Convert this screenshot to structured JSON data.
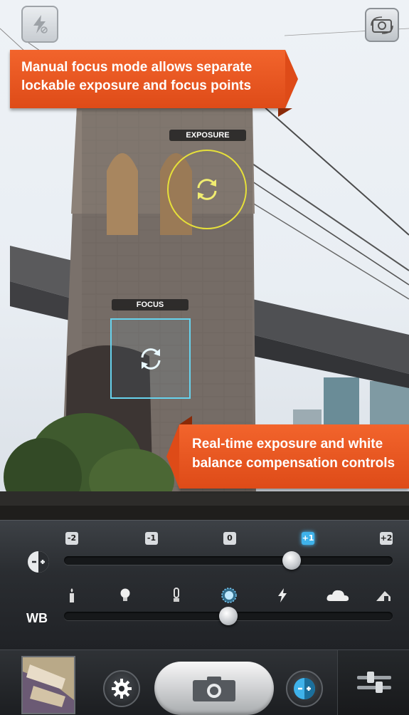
{
  "annotations": {
    "top_ribbon": [
      "Manual focus mode allows separate",
      "lockable exposure and focus points"
    ],
    "bottom_ribbon": [
      "Real-time exposure and white",
      "balance compensation controls"
    ]
  },
  "overlays": {
    "exposure_label": "EXPOSURE",
    "focus_label": "FOCUS"
  },
  "top_controls": {
    "flash_icon": "flash-off-icon",
    "camera_flip_icon": "camera-switch-icon"
  },
  "exposure": {
    "icon": "exposure-compensation-icon",
    "labels": [
      "-2",
      "-1",
      "0",
      "+1",
      "+2"
    ],
    "selected": "+1",
    "value_fraction": 0.75
  },
  "white_balance": {
    "label": "WB",
    "presets": [
      "candle-icon",
      "bulb-icon",
      "fluorescent-icon",
      "daylight-icon",
      "flash-icon",
      "cloudy-icon",
      "shade-icon"
    ],
    "selected": "daylight-icon",
    "value_fraction": 0.5,
    "accent": "#3fb2ea"
  },
  "bottom_bar": {
    "gallery_icon": "photo-thumbnail",
    "settings_icon": "gear-icon",
    "shutter_icon": "camera-icon",
    "mode_icon": "exposure-mode-icon",
    "sliders_icon": "sliders-icon"
  },
  "colors": {
    "ribbon": "#e8531f",
    "exposure_ring": "#e6e03a",
    "focus_box": "#67d3ee"
  }
}
